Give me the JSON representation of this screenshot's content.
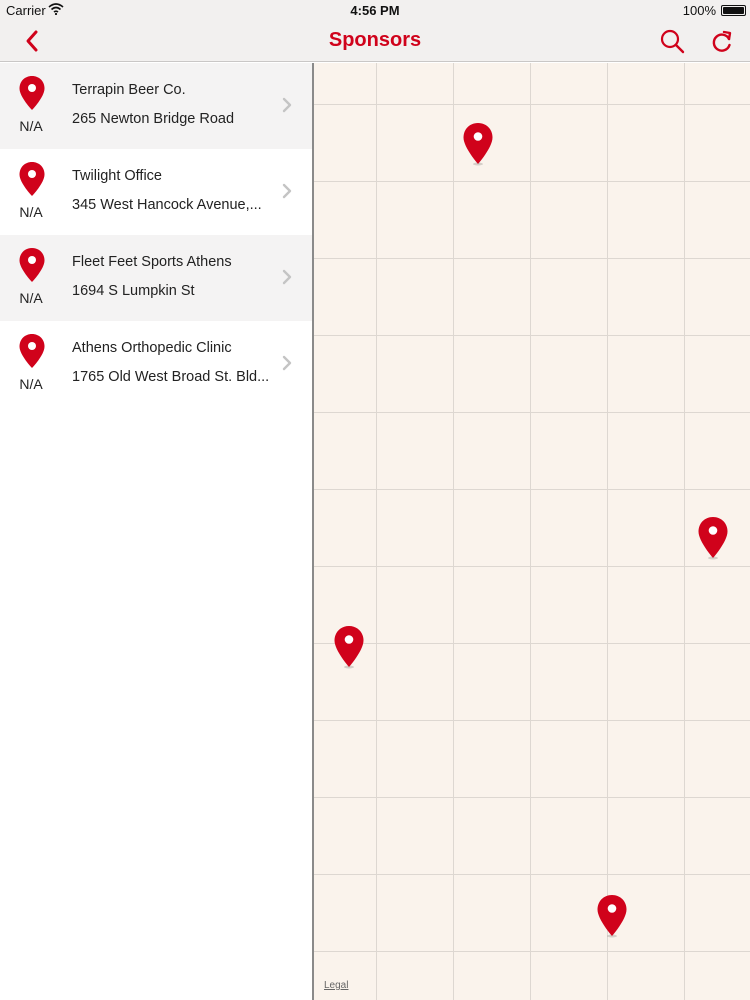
{
  "status_bar": {
    "carrier": "Carrier",
    "time": "4:56 PM",
    "battery": "100%"
  },
  "nav": {
    "title": "Sponsors",
    "accent_color": "#d0021b",
    "icons": [
      "chevron-left-icon",
      "search-icon",
      "refresh-icon"
    ]
  },
  "sponsors": [
    {
      "name": "Terrapin Beer Co.",
      "address": "265 Newton Bridge Road",
      "distance": "N/A"
    },
    {
      "name": "Twilight Office",
      "address": "345 West Hancock Avenue,...",
      "distance": "N/A"
    },
    {
      "name": "Fleet Feet Sports Athens",
      "address": "1694 S Lumpkin St",
      "distance": "N/A"
    },
    {
      "name": "Athens Orthopedic Clinic",
      "address": "1765 Old West Broad St. Bld...",
      "distance": "N/A"
    }
  ],
  "map": {
    "legal": "Legal",
    "marker_icon": "map-pin-icon",
    "marker_count": 4
  }
}
